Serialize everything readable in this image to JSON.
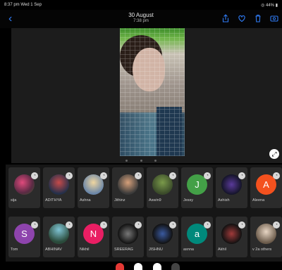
{
  "status": {
    "time": "8:37 pm  Wed 1 Sep",
    "battery": "◎ 44% ▮"
  },
  "nav": {
    "back": "‹",
    "title": "30 August",
    "subtitle": "7:38 pm"
  },
  "colors": {
    "accent": "#2f7cf6"
  },
  "people": [
    {
      "name": "sija",
      "initial": "",
      "bg": "radial-gradient(circle at 40% 40%,#e04a7c,#5a2a44 60%,#3a5a2a)"
    },
    {
      "name": "ADITHYA",
      "initial": "",
      "bg": "radial-gradient(circle at 50% 40%,#c64a4a,#24304a 70%)"
    },
    {
      "name": "Ashna",
      "initial": "",
      "bg": "radial-gradient(circle at 50% 40%,#f0d6a0,#6a86a8 70%)"
    },
    {
      "name": "Jithinz",
      "initial": "",
      "bg": "radial-gradient(circle at 50% 40%,#d6a07a,#3a3a3a 70%)"
    },
    {
      "name": "Aswin9",
      "initial": "",
      "bg": "radial-gradient(circle at 50% 40%,#7a9a4a,#3a4a2a 70%)"
    },
    {
      "name": "Jessy",
      "initial": "J",
      "bg": "#43a047"
    },
    {
      "name": "Ashish",
      "initial": "",
      "bg": "radial-gradient(circle at 50% 50%,#5a3a9a,#141428 70%)"
    },
    {
      "name": "Aleena",
      "initial": "A",
      "bg": "#f4511e"
    },
    {
      "name": "Tom",
      "initial": "S",
      "bg": "#8e44ad"
    },
    {
      "name": "ABHINAV",
      "initial": "",
      "bg": "radial-gradient(circle at 50% 30%,#7fc4d4,#2a4a3a 70%)"
    },
    {
      "name": "Nikhil",
      "initial": "N",
      "bg": "#e91e63"
    },
    {
      "name": "SREERAG",
      "initial": "",
      "bg": "radial-gradient(circle at 50% 50%,#777,#111 70%)"
    },
    {
      "name": "JISHNU",
      "initial": "",
      "bg": "radial-gradient(circle at 50% 50%,#3a5aa0,#111 70%)"
    },
    {
      "name": "asnna",
      "initial": "a",
      "bg": "#00897b"
    },
    {
      "name": "Akhil",
      "initial": "",
      "bg": "radial-gradient(circle at 50% 50%,#a03a3a,#111 70%)"
    },
    {
      "name": "v  2a others",
      "initial": "",
      "bg": "radial-gradient(circle at 50% 40%,#e8d6c4,#6a5a4a 70%)"
    }
  ],
  "bottom_buttons": [
    {
      "name": "record",
      "color": "#e53935"
    },
    {
      "name": "option-1",
      "color": "#ffffff"
    },
    {
      "name": "option-2",
      "color": "#ffffff"
    },
    {
      "name": "option-3",
      "color": "#444444"
    }
  ]
}
